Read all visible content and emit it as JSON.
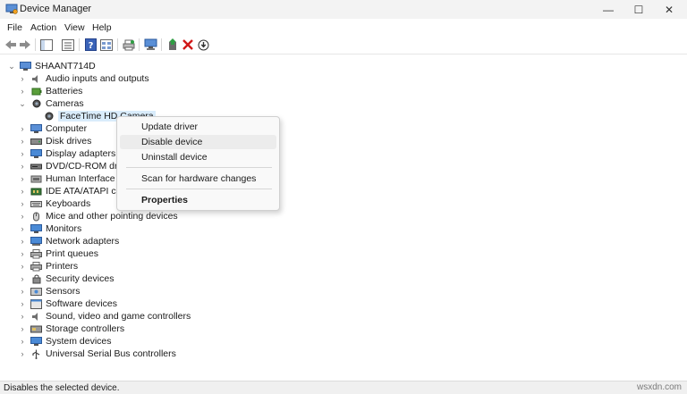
{
  "window": {
    "title": "Device Manager",
    "minimize": "—",
    "maximize": "☐",
    "close": "✕"
  },
  "menu": [
    "File",
    "Action",
    "View",
    "Help"
  ],
  "tree": {
    "root": "SHAANT714D",
    "categories": [
      {
        "label": "Audio inputs and outputs",
        "icon": "speaker-icon"
      },
      {
        "label": "Batteries",
        "icon": "battery-icon"
      },
      {
        "label": "Cameras",
        "icon": "camera-icon",
        "expanded": true
      },
      {
        "label": "Computer",
        "icon": "computer-icon"
      },
      {
        "label": "Disk drives",
        "icon": "disk-icon"
      },
      {
        "label": "Display adapters",
        "icon": "monitor-icon"
      },
      {
        "label": "DVD/CD-ROM drive",
        "icon": "dvd-icon"
      },
      {
        "label": "Human Interface De",
        "icon": "hid-icon"
      },
      {
        "label": "IDE ATA/ATAPI contr",
        "icon": "ide-icon"
      },
      {
        "label": "Keyboards",
        "icon": "keyboard-icon"
      },
      {
        "label": "Mice and other pointing devices",
        "icon": "mouse-icon"
      },
      {
        "label": "Monitors",
        "icon": "monitor-icon"
      },
      {
        "label": "Network adapters",
        "icon": "network-icon"
      },
      {
        "label": "Print queues",
        "icon": "printer-icon"
      },
      {
        "label": "Printers",
        "icon": "printer-icon"
      },
      {
        "label": "Security devices",
        "icon": "security-icon"
      },
      {
        "label": "Sensors",
        "icon": "sensor-icon"
      },
      {
        "label": "Software devices",
        "icon": "software-icon"
      },
      {
        "label": "Sound, video and game controllers",
        "icon": "speaker-icon"
      },
      {
        "label": "Storage controllers",
        "icon": "storage-icon"
      },
      {
        "label": "System devices",
        "icon": "system-icon"
      },
      {
        "label": "Universal Serial Bus controllers",
        "icon": "usb-icon"
      }
    ],
    "camera_child": "FaceTime HD Camera"
  },
  "context_menu": {
    "update": "Update driver",
    "disable": "Disable device",
    "uninstall": "Uninstall device",
    "scan": "Scan for hardware changes",
    "properties": "Properties"
  },
  "status": {
    "text": "Disables the selected device.",
    "watermark": "wsxdn.com"
  },
  "colors": {
    "selection": "#d9ecfb",
    "hover": "#ececec"
  }
}
